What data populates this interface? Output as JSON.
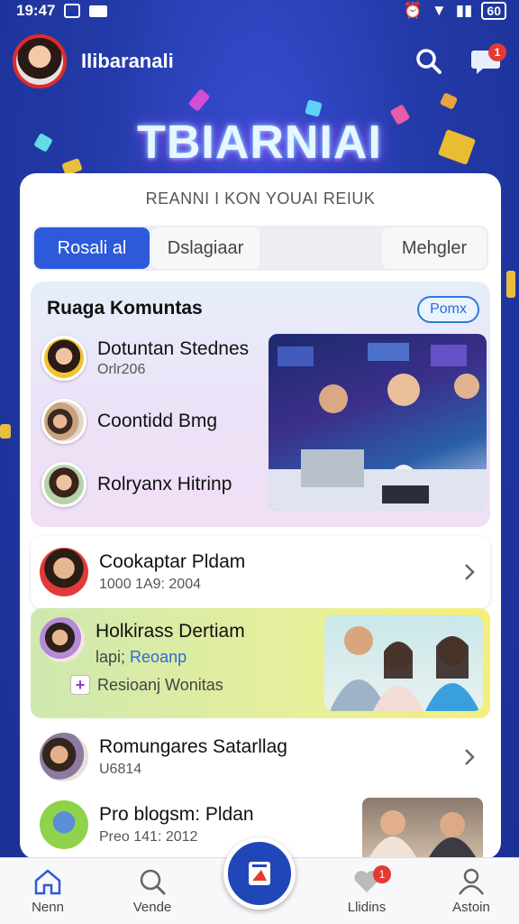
{
  "status_bar": {
    "time": "19:47",
    "battery": "60"
  },
  "header": {
    "app_name": "Ilibaranali",
    "chat_badge": "1"
  },
  "banner": {
    "title": "TBIARNIAI"
  },
  "card": {
    "subtitle": "REANNI I KON YOUAI REIUK",
    "tabs": [
      "Rosali al",
      "Dslagiaar",
      "Mehgler"
    ]
  },
  "community": {
    "title": "Ruaga Komuntas",
    "button": "Pomx",
    "members": [
      {
        "name": "Dotuntan Stednes",
        "sub": "Orlr206"
      },
      {
        "name": "Coontidd Bmg",
        "sub": ""
      },
      {
        "name": "Rolryanx Hitrinp",
        "sub": ""
      }
    ]
  },
  "list": [
    {
      "title": "Cookaptar Pldam",
      "sub": "1000 1A9: 2004"
    },
    {
      "title": "Holkirass Dertiam",
      "sub_prefix": "lapi;",
      "link": "Reoanp",
      "tag": "Resioanj  Wonitas"
    },
    {
      "title": "Romungares Satarllag",
      "sub": "U6814"
    },
    {
      "title": "Pro blogsm: Pldan",
      "sub": "Preo 141: 2012"
    }
  ],
  "nav": {
    "items": [
      {
        "label": "Nenn"
      },
      {
        "label": "Vende"
      },
      {
        "label": "Llidins",
        "badge": "1"
      },
      {
        "label": "Astoin"
      }
    ]
  },
  "colors": {
    "accent": "#2d5ad8",
    "background": "#1f3fae",
    "badge": "#e53935"
  }
}
